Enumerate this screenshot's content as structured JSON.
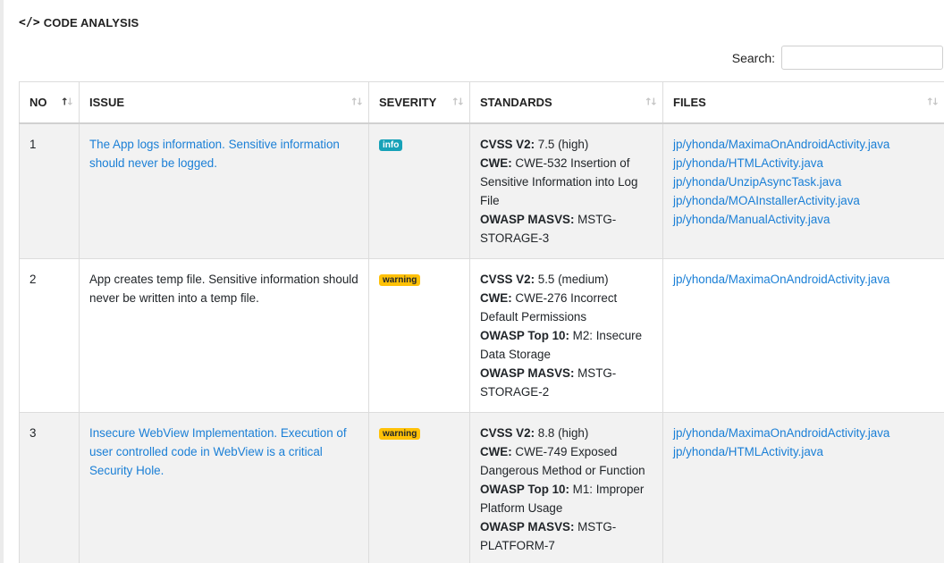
{
  "section": {
    "icon": "code-icon",
    "title": "CODE ANALYSIS"
  },
  "search": {
    "label": "Search:",
    "value": "",
    "placeholder": ""
  },
  "table": {
    "columns": [
      "NO",
      "ISSUE",
      "SEVERITY",
      "STANDARDS",
      "FILES"
    ],
    "sort": {
      "column": "NO",
      "direction": "ascending"
    },
    "rows": [
      {
        "no": "1",
        "issue": "The App logs information. Sensitive information should never be logged.",
        "issue_is_link": true,
        "severity": "info",
        "standards": [
          {
            "key": "CVSS V2:",
            "value": " 7.5 (high)"
          },
          {
            "key": "CWE:",
            "value": " CWE-532 Insertion of Sensitive Information into Log File"
          },
          {
            "key": "OWASP MASVS:",
            "value": " MSTG-STORAGE-3"
          }
        ],
        "files": [
          "jp/yhonda/MaximaOnAndroidActivity.java",
          "jp/yhonda/HTMLActivity.java",
          "jp/yhonda/UnzipAsyncTask.java",
          "jp/yhonda/MOAInstallerActivity.java",
          "jp/yhonda/ManualActivity.java"
        ]
      },
      {
        "no": "2",
        "issue": "App creates temp file. Sensitive information should never be written into a temp file.",
        "issue_is_link": false,
        "severity": "warning",
        "standards": [
          {
            "key": "CVSS V2:",
            "value": " 5.5 (medium)"
          },
          {
            "key": "CWE:",
            "value": " CWE-276 Incorrect Default Permissions"
          },
          {
            "key": "OWASP Top 10:",
            "value": " M2: Insecure Data Storage"
          },
          {
            "key": "OWASP MASVS:",
            "value": " MSTG-STORAGE-2"
          }
        ],
        "files": [
          "jp/yhonda/MaximaOnAndroidActivity.java"
        ]
      },
      {
        "no": "3",
        "issue": "Insecure WebView Implementation. Execution of user controlled code in WebView is a critical Security Hole.",
        "issue_is_link": true,
        "severity": "warning",
        "standards": [
          {
            "key": "CVSS V2:",
            "value": " 8.8 (high)"
          },
          {
            "key": "CWE:",
            "value": " CWE-749 Exposed Dangerous Method or Function"
          },
          {
            "key": "OWASP Top 10:",
            "value": " M1: Improper Platform Usage"
          },
          {
            "key": "OWASP MASVS:",
            "value": " MSTG-PLATFORM-7"
          }
        ],
        "files": [
          "jp/yhonda/MaximaOnAndroidActivity.java",
          "jp/yhonda/HTMLActivity.java"
        ]
      }
    ]
  },
  "colors": {
    "link": "#1a7fd6",
    "info_badge": "#17a2b8",
    "warning_badge": "#ffc107",
    "odd_row": "#f2f2f2"
  }
}
